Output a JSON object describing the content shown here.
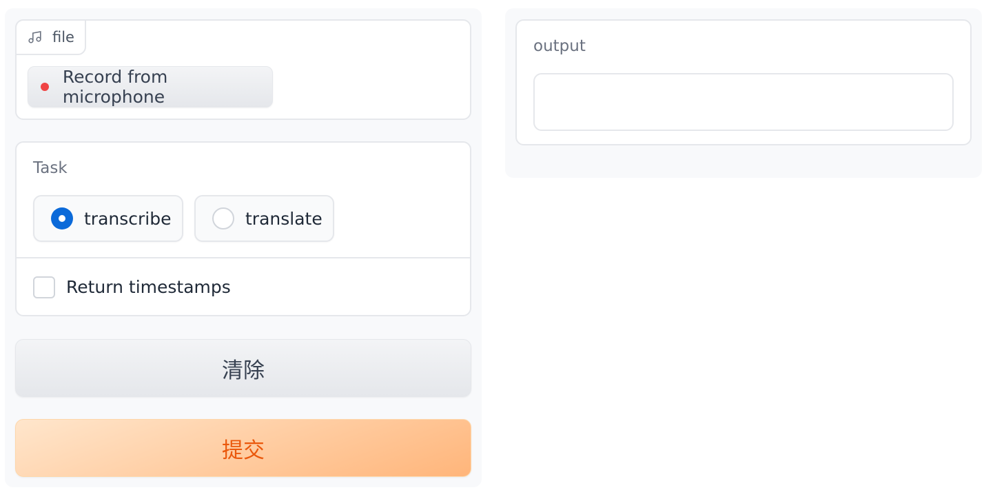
{
  "audio_input": {
    "source_tab_label": "file",
    "source_tab_icon": "music-note-icon",
    "record_button_label": "Record from microphone"
  },
  "task": {
    "label": "Task",
    "options": [
      {
        "label": "transcribe",
        "selected": true
      },
      {
        "label": "translate",
        "selected": false
      }
    ]
  },
  "timestamps": {
    "label": "Return timestamps",
    "checked": false
  },
  "actions": {
    "clear_label": "清除",
    "submit_label": "提交"
  },
  "output": {
    "label": "output",
    "value": ""
  },
  "colors": {
    "accent": "#0b6ad9",
    "record_dot": "#ef4444",
    "submit_text": "#ea580c"
  }
}
